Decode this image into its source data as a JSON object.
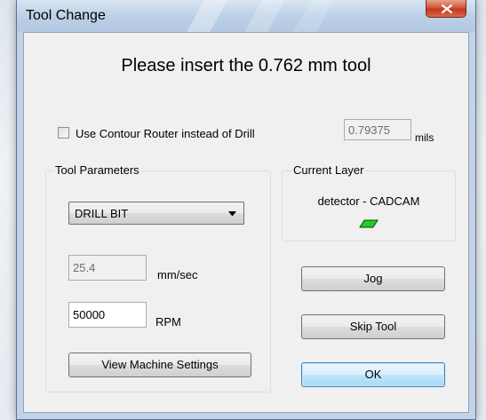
{
  "window": {
    "title": "Tool Change"
  },
  "heading": "Please insert the 0.762 mm tool",
  "contour": {
    "checkbox_label": "Use Contour Router instead of Drill",
    "checked": false,
    "value": "0.79375",
    "unit": "mils"
  },
  "tool_parameters": {
    "title": "Tool Parameters",
    "tool_type": "DRILL BIT",
    "speed_value": "25.4",
    "speed_unit": "mm/sec",
    "rpm_value": "50000",
    "rpm_unit": "RPM",
    "machine_settings_label": "View Machine Settings"
  },
  "current_layer": {
    "title": "Current Layer",
    "name": "detector - CADCAM",
    "swatch_color": "#22cc22"
  },
  "buttons": {
    "jog": "Jog",
    "skip_tool": "Skip Tool",
    "ok": "OK"
  },
  "colors": {
    "title_bar": "#b3c9e2",
    "close_button": "#c03a1f",
    "default_button_border": "#3c7fb1"
  }
}
